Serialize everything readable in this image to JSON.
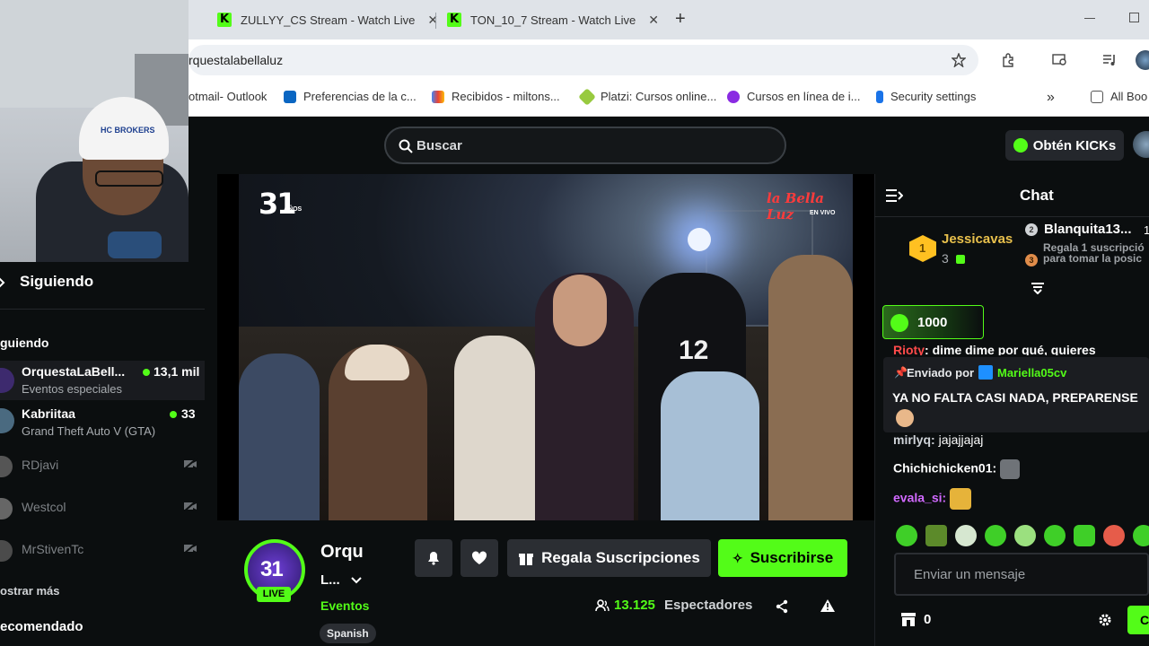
{
  "browser": {
    "tabs": [
      {
        "title": "ZULLYY_CS Stream - Watch Live",
        "close": "✕"
      },
      {
        "title": "TON_10_7 Stream - Watch Live",
        "close": "✕"
      }
    ],
    "new_tab": "+",
    "url": "rquestalabellaluz",
    "bookmarks": [
      {
        "label": "otmail- Outlook"
      },
      {
        "label": "Preferencias de la c..."
      },
      {
        "label": "Recibidos - miltons..."
      },
      {
        "label": "Platzi: Cursos online..."
      },
      {
        "label": "Cursos en línea de i..."
      },
      {
        "label": "Security settings"
      },
      {
        "label": "All Boo"
      }
    ],
    "bookmarks_more": "»"
  },
  "webcam": {
    "cap_text": "HC BROKERS"
  },
  "header": {
    "search_placeholder": "Buscar",
    "get_kicks": "Obtén KICKs"
  },
  "sidebar": {
    "following_title": "Siguiendo",
    "section_label": "guiendo",
    "channels": [
      {
        "name": "OrquestaLaBell...",
        "category": "Eventos especiales",
        "viewers": "13,1 mil",
        "live": true
      },
      {
        "name": "Kabriitaa",
        "category": "Grand Theft Auto V (GTA)",
        "viewers": "33",
        "live": true
      },
      {
        "name": "RDjavi",
        "live": false
      },
      {
        "name": "Westcol",
        "live": false
      },
      {
        "name": "MrStivenTc",
        "live": false
      }
    ],
    "show_more": "ostrar más",
    "recommended": "ecomendado"
  },
  "video": {
    "logo_31": "31",
    "logo_31_sub": "AÑOS",
    "brand": "la Bella Luz",
    "brand_sub": "EN VIVO",
    "jersey_number": "12"
  },
  "stream": {
    "avatar_text": "31",
    "live_badge": "LIVE",
    "title": "Orqu",
    "subtitle": "L...",
    "category": "Eventos",
    "language": "Spanish",
    "gift_subs": "Regala Suscripciones",
    "subscribe": "Suscribirse",
    "viewers_count": "13.125",
    "viewers_label": "Espectadores"
  },
  "chat": {
    "title": "Chat",
    "leaderboard": [
      {
        "rank": "1",
        "name": "Jessicavas",
        "count": "3"
      },
      {
        "rank": "2",
        "name": "Blanquita13..."
      },
      {
        "rank": "3",
        "name": "Regala 1 suscripció para tomar la posic"
      }
    ],
    "leaderboard_rank1_suffix": "1",
    "kicks_goal": "1000",
    "cut_message": {
      "user": "Rioty",
      "text": "dime dime por qué, quieres marcharte"
    },
    "pinned": {
      "label": "Enviado por",
      "user": "Mariella05cv",
      "text": "YA NO FALTA CASI NADA, PREPARENSE"
    },
    "messages": [
      {
        "user": "mirlyq:",
        "text": "jajajjajaj",
        "color": "#cfd3d8"
      },
      {
        "user": "Chichichicken01:",
        "text": "",
        "color": "#ffffff"
      },
      {
        "user": "evala_si:",
        "text": "",
        "color": "#d169ff"
      }
    ],
    "input_placeholder": "Enviar un mensaje",
    "store_count": "0",
    "send_label": "C"
  },
  "colors": {
    "kick_green": "#53fc18",
    "bg": "#0b0e0f"
  }
}
